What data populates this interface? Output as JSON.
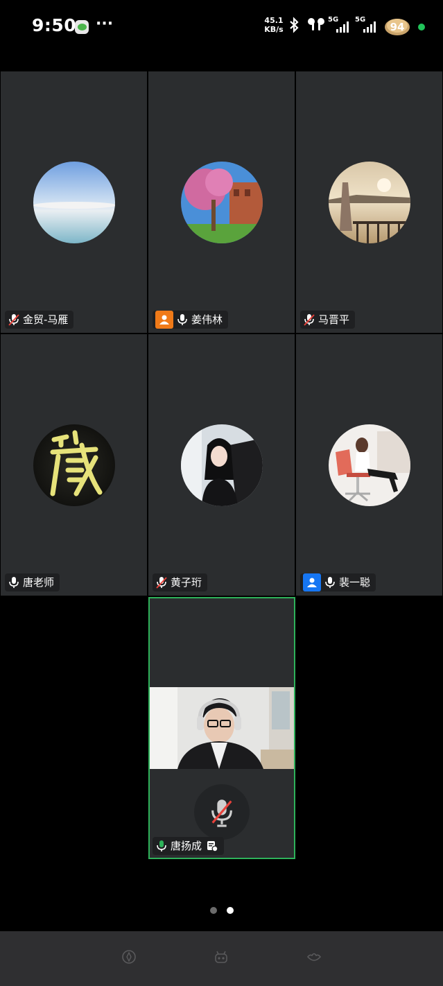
{
  "status_bar": {
    "time": "9:50",
    "more": "···",
    "net_speed_value": "45.1",
    "net_speed_unit": "KB/s",
    "sim1_label": "5G",
    "sim2_label": "5G",
    "battery_level": "94"
  },
  "participants": [
    {
      "name": "金贸-马雁",
      "mic": "muted",
      "avatar": "sky-sea-avatar"
    },
    {
      "name": "姜伟林",
      "mic": "on",
      "avatar": "flower-tree-avatar",
      "badge": "host-orange"
    },
    {
      "name": "马晋平",
      "mic": "muted",
      "avatar": "sunset-lake-avatar"
    },
    {
      "name": "唐老师",
      "mic": "on",
      "avatar": "calligraphy-avatar"
    },
    {
      "name": "黄子珩",
      "mic": "muted",
      "avatar": "girl-avatar"
    },
    {
      "name": "裴一聪",
      "mic": "on",
      "avatar": "chair-avatar",
      "badge": "cohost-blue"
    }
  ],
  "self_view": {
    "name": "唐扬成",
    "mic": "on"
  },
  "pager": {
    "pages": 2,
    "current": 2
  },
  "colors": {
    "tile_bg": "#2b2d2f",
    "active_border": "#2eb25a",
    "host_badge": "#f07a18",
    "cohost_badge": "#1676f3",
    "muted_red": "#e8413a"
  }
}
